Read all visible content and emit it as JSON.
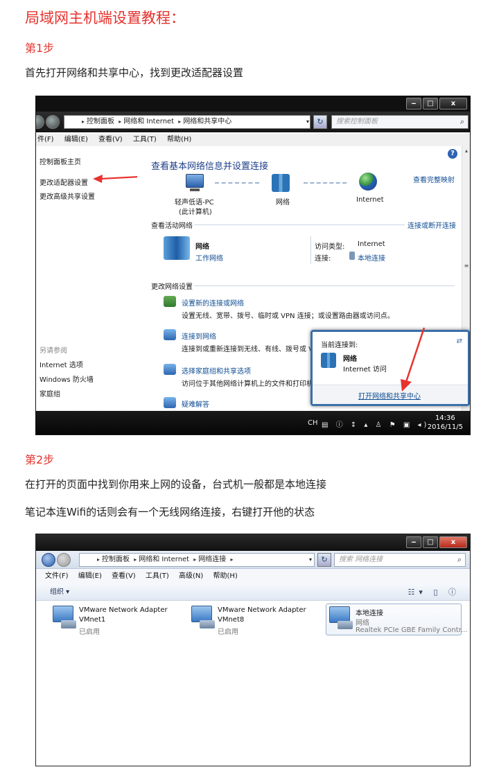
{
  "article": {
    "title": "局域网主机端设置教程：",
    "step1": {
      "heading": "第1步",
      "text": "首先打开网络和共享中心，找到更改适配器设置"
    },
    "step2": {
      "heading": "第2步",
      "text1": "在打开的页面中找到你用来上网的设备，台式机一般都是本地连接",
      "text2": "笔记本连Wifi的话则会有一个无线网络连接，右键打开他的状态"
    }
  },
  "shot1": {
    "window_buttons": {
      "minimize": "‒",
      "maximize": "□",
      "close": "x"
    },
    "address": {
      "crumbs": [
        "控制面板",
        "网络和 Internet",
        "网络和共享中心"
      ]
    },
    "search_placeholder": "搜索控制面板",
    "menu": [
      "件(F)",
      "编辑(E)",
      "查看(V)",
      "工具(T)",
      "帮助(H)"
    ],
    "left": {
      "home": "控制面板主页",
      "change_adapter": "更改适配器设置",
      "advanced_sharing": "更改高级共享设置",
      "see_also": "另请参阅",
      "internet_options": "Internet 选项",
      "firewall": "Windows 防火墙",
      "homegroup": "家庭组"
    },
    "main": {
      "heading": "查看基本网络信息并设置连接",
      "view_full_map": "查看完整映射",
      "node_pc_line1": "轻声低语-PC",
      "node_pc_line2": "(此计算机)",
      "node_network": "网络",
      "node_internet": "Internet",
      "active_networks_label": "查看活动网络",
      "connect_or_disconnect": "连接或断开连接",
      "network_name": "网络",
      "network_type": "工作网络",
      "access_type_label": "访问类型:",
      "access_type_value": "Internet",
      "connection_label": "连接:",
      "connection_value": "本地连接",
      "change_settings_label": "更改网络设置",
      "task1_link": "设置新的连接或网络",
      "task1_desc": "设置无线、宽带、拨号、临时或 VPN 连接；或设置路由器或访问点。",
      "task2_link": "连接到网络",
      "task2_desc": "连接到或重新连接到无线、有线、拨号或 V",
      "task3_link": "选择家庭组和共享选项",
      "task3_desc": "访问位于其他网络计算机上的文件和打印机",
      "task4_link": "疑难解答"
    },
    "popup": {
      "header": "当前连接到:",
      "network": "网络",
      "access": "Internet 访问",
      "open_center": "打开网络和共享中心"
    },
    "taskbar": {
      "lang": "CH",
      "time": "14:36",
      "date": "2016/11/5"
    }
  },
  "shot2": {
    "address": {
      "crumbs": [
        "控制面板",
        "网络和 Internet",
        "网络连接"
      ]
    },
    "search_placeholder": "搜索 网络连接",
    "menu": [
      "文件(F)",
      "编辑(E)",
      "查看(V)",
      "工具(T)",
      "高级(N)",
      "帮助(H)"
    ],
    "organize": "组织 ▾",
    "adapters": [
      {
        "name": "VMware Network Adapter",
        "sub": "VMnet1",
        "status": "已启用"
      },
      {
        "name": "VMware Network Adapter",
        "sub": "VMnet8",
        "status": "已启用"
      },
      {
        "name": "本地连接",
        "sub": "网络",
        "status": "Realtek PCIe GBE Family Contr..."
      }
    ]
  },
  "colors": {
    "heading_red": "#e5322d",
    "link_blue": "#0e4c92",
    "arrow_red": "#e8322e"
  }
}
